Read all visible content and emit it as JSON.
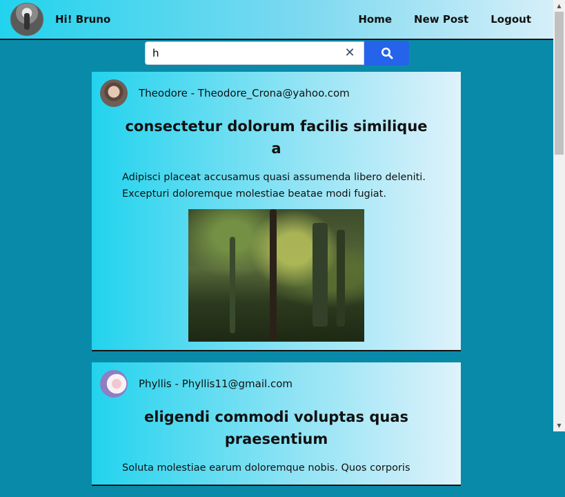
{
  "navbar": {
    "greeting": "Hi! Bruno",
    "links": [
      "Home",
      "New Post",
      "Logout"
    ]
  },
  "search": {
    "value": "h"
  },
  "posts": [
    {
      "author": "Theodore - Theodore_Crona@yahoo.com",
      "title": "consectetur dolorum facilis similique a",
      "body": "Adipisci placeat accusamus quasi assumenda libero deleniti. Excepturi doloremque molestiae beatae modi fugiat."
    },
    {
      "author": "Phyllis - Phyllis11@gmail.com",
      "title": "eligendi commodi voluptas quas praesentium",
      "body": "Soluta molestiae earum doloremque nobis. Quos corporis"
    }
  ],
  "colors": {
    "background": "#0a8aa9",
    "accent": "#2563eb"
  }
}
